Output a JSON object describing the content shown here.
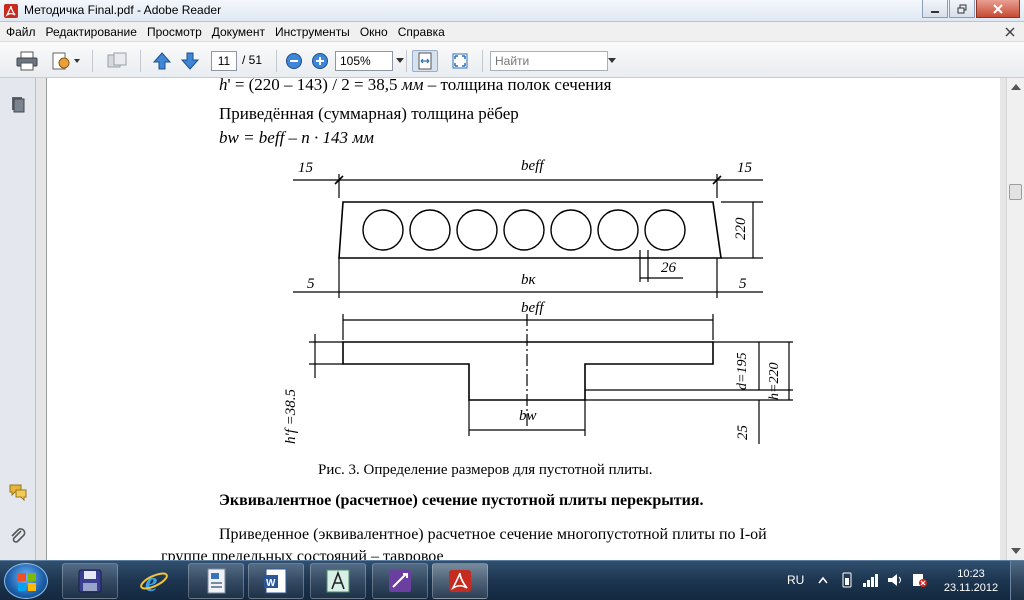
{
  "window": {
    "title": "Методичка Final.pdf - Adobe Reader",
    "icon": "adobe-reader-icon"
  },
  "menu": {
    "items": [
      "Файл",
      "Редактирование",
      "Просмотр",
      "Документ",
      "Инструменты",
      "Окно",
      "Справка"
    ]
  },
  "toolbar": {
    "current_page": "11",
    "page_total": "/ 51",
    "zoom": "105%",
    "find_placeholder": "Найти",
    "icons": [
      "printer-icon",
      "sign-icon",
      "collaborate-icon",
      "prev-page-icon",
      "next-page-icon",
      "zoom-out-icon",
      "zoom-in-icon",
      "fit-width-icon",
      "full-screen-icon"
    ]
  },
  "document": {
    "line1_formula": "h",
    "line1_rest": "' = (220 – 143) / 2 = 38,5",
    "line1_unit": "мм",
    "line1_text": "– толщина полок сечения",
    "line2": "Приведённая (суммарная) толщина рёбер",
    "line3_formula": "bw = beff – n · 143",
    "line3_unit": "мм",
    "diagram": {
      "top_left": "15",
      "top_right": "15",
      "beff_top": "beff",
      "height_220": "220",
      "rib_26": "26",
      "bottom_left": "5",
      "bottom_right": "5",
      "bk": "bк",
      "beff_2": "beff",
      "bw": "bw",
      "hf": "h'f =38.5",
      "d": "d=195",
      "h": "h=220",
      "cover": "25",
      "void_count": 7
    },
    "caption": "Рис.  3. Определение размеров для пустотной плиты.",
    "heading": "Эквивалентное (расчетное) сечение пустотной плиты перекрытия.",
    "para_line1": "Приведенное (эквивалентное) расчетное сечение многопустотной плиты по I-ой",
    "para_line2": "группе предельных состояний – тавровое"
  },
  "taskbar": {
    "lang": "RU",
    "time": "10:23",
    "date": "23.11.2012",
    "apps": [
      "save-app-icon",
      "internet-explorer-icon",
      "file-app-icon",
      "word-icon",
      "autocad-icon",
      "visual-studio-icon",
      "adobe-reader-icon"
    ]
  },
  "colors": {
    "accent": "#1e3a5a",
    "reader_red": "#c62b1f"
  }
}
